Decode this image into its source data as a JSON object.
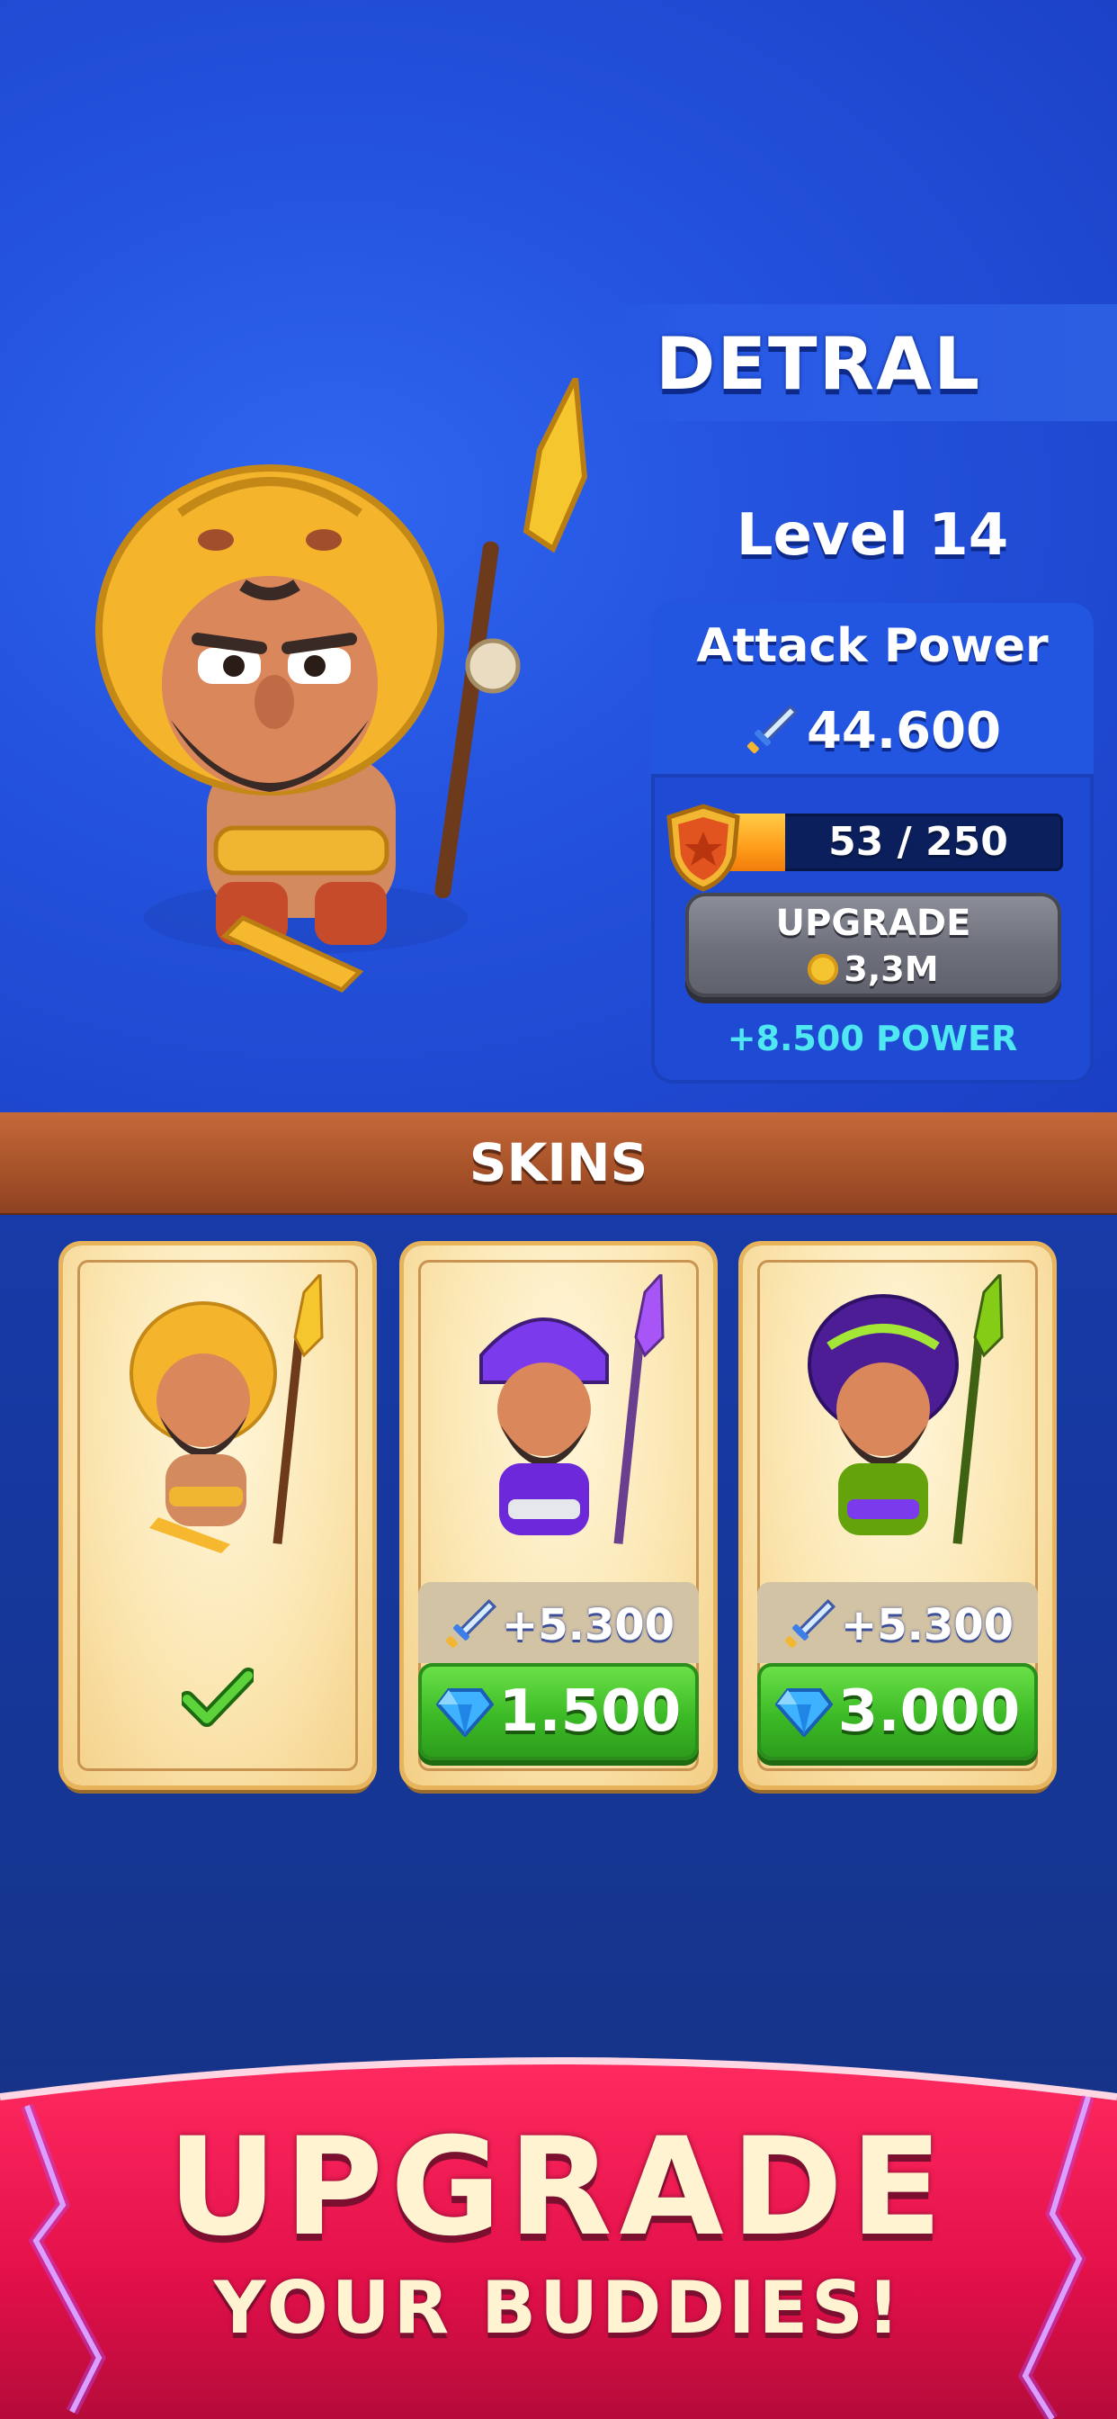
{
  "hero": {
    "name": "DETRAL",
    "level": "Level 14"
  },
  "stats": {
    "attack_title": "Attack Power",
    "attack_value": "44.600",
    "progress_text": "53 / 250",
    "progress_fraction": 0.212,
    "upgrade_label": "UPGRADE",
    "upgrade_cost": "3,3M",
    "power_bonus": "+8.500 POWER"
  },
  "skins": {
    "title": "SKINS",
    "items": [
      {
        "owned": true,
        "theme": "lion-gold"
      },
      {
        "bonus": "+5.300",
        "price": "1.500",
        "theme": "purple-samurai"
      },
      {
        "bonus": "+5.300",
        "price": "3.000",
        "theme": "green-tiger"
      }
    ]
  },
  "promo": {
    "line1": "UPGRADE",
    "line2": "YOUR BUDDIES!"
  },
  "colors": {
    "background": "#1f48c9",
    "wood": "#a8532a",
    "buy_green": "#3cba26",
    "bonus_cyan": "#4fe8f2",
    "promo_red": "#e8134a"
  },
  "icons": [
    "sword-icon",
    "shield-star-icon",
    "coin-icon",
    "gem-icon",
    "check-icon"
  ]
}
